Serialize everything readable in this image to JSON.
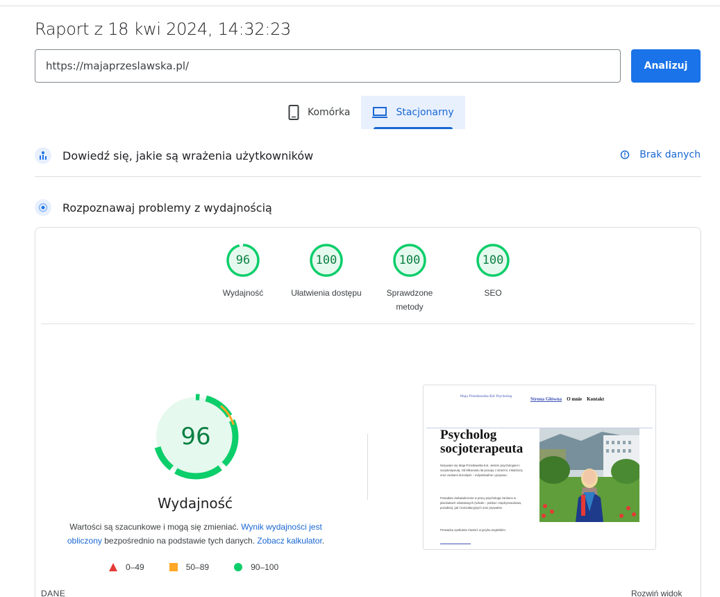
{
  "report": {
    "title": "Raport z 18 kwi 2024, 14:32:23"
  },
  "search": {
    "url": "https://majaprzeslawska.pl/",
    "button": "Analizuj"
  },
  "tabs": [
    {
      "label": "Komórka",
      "icon": "smartphone-icon",
      "active": false
    },
    {
      "label": "Stacjonarny",
      "icon": "laptop-icon",
      "active": true
    }
  ],
  "field_section": {
    "label": "Dowiedź się, jakie są wrażenia użytkowników",
    "status": "Brak danych"
  },
  "lab_section": {
    "label": "Rozpoznawaj problemy z wydajnością"
  },
  "scores": [
    {
      "value": "96",
      "label": "Wydajność"
    },
    {
      "value": "100",
      "label": "Ułatwienia dostępu"
    },
    {
      "value": "100",
      "label": "Sprawdzone metody"
    },
    {
      "value": "100",
      "label": "SEO"
    }
  ],
  "performance": {
    "score": "96",
    "label": "Wydajność",
    "note_part1": "Wartości są szacunkowe i mogą się zmieniać. ",
    "note_link1": "Wynik wydajności jest obliczony",
    "note_part2": " bezpośrednio na podstawie tych danych. ",
    "note_link2": "Zobacz kalkulator",
    "note_part3": "."
  },
  "legend": [
    {
      "range": "0–49",
      "shape": "triangle",
      "color": "#e53935"
    },
    {
      "range": "50–89",
      "shape": "square",
      "color": "#ffa726"
    },
    {
      "range": "90–100",
      "shape": "circle",
      "color": "#0cce6b"
    }
  ],
  "preview": {
    "logo": "Maja Przesławska-Kot Psycholog",
    "nav": [
      "Strona Główna",
      "O mnie",
      "Kontakt"
    ],
    "heading_line1": "Psycholog",
    "heading_line2": "socjoterapeuta",
    "para1": "Nazywam się Maja Przesławska-Kot. Jestem psychologiem i socjoterapeutą. Od kilkunastu lat pracuję z dziećmi, młodzieżą oraz osobami dorosłymi – indywidualnie i grupowo.",
    "para2": "Posiadam doświadczenie w pracy psychologa zarówno w placówkach oświatowych (szkoła – polska i międzynarodowa, poradnia), jak i konsultacyjnych oraz prywatnie.",
    "para3": "Prowadzę spotkania również w języku angielskim."
  },
  "footer": {
    "left": "DANE",
    "right": "Rozwiń widok"
  },
  "colors": {
    "accent": "#1a73e8",
    "pass": "#0cce6b",
    "pass_text": "#0b8043",
    "average": "#ffa726"
  }
}
